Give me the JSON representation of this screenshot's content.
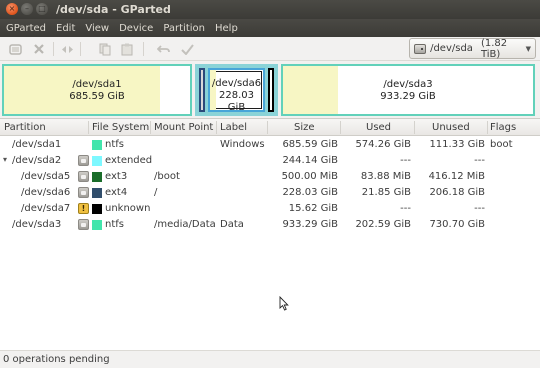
{
  "window": {
    "title": "/dev/sda - GParted",
    "close_glyph": "×",
    "min_glyph": "–",
    "max_glyph": "□"
  },
  "menubar": [
    "GParted",
    "Edit",
    "View",
    "Device",
    "Partition",
    "Help"
  ],
  "toolbar": {
    "icons": [
      "new-icon",
      "delete-icon",
      "resize-icon",
      "copy-icon",
      "paste-icon",
      "undo-icon",
      "apply-icon"
    ],
    "device_name": "/dev/sda",
    "device_size": "(1.82 TiB)"
  },
  "diskmap": {
    "sda1": {
      "name": "/dev/sda1",
      "size": "685.59 GiB",
      "used_fraction": 0.84
    },
    "sda6": {
      "name": "/dev/sda6",
      "size": "228.03 GiB"
    },
    "sda3": {
      "name": "/dev/sda3",
      "size": "933.29 GiB",
      "used_fraction": 0.22
    }
  },
  "columns": [
    "Partition",
    "File System",
    "Mount Point",
    "Label",
    "Size",
    "Used",
    "Unused",
    "Flags"
  ],
  "rows": [
    {
      "partition": "/dev/sda1",
      "fs": "ntfs",
      "fs_color": "#42e5ac",
      "mount": "",
      "label": "Windows",
      "size": "685.59 GiB",
      "used": "574.26 GiB",
      "unused": "111.33 GiB",
      "flags": "boot",
      "indent": 0,
      "expander": "",
      "icon": "none"
    },
    {
      "partition": "/dev/sda2",
      "fs": "extended",
      "fs_color": "#7df8ff",
      "mount": "",
      "label": "",
      "size": "244.14 GiB",
      "used": "---",
      "unused": "---",
      "flags": "",
      "indent": 0,
      "expander": "▾",
      "icon": "lock"
    },
    {
      "partition": "/dev/sda5",
      "fs": "ext3",
      "fs_color": "#1a6d2a",
      "mount": "/boot",
      "label": "",
      "size": "500.00 MiB",
      "used": "83.88 MiB",
      "unused": "416.12 MiB",
      "flags": "",
      "indent": 1,
      "expander": "",
      "icon": "lock"
    },
    {
      "partition": "/dev/sda6",
      "fs": "ext4",
      "fs_color": "#314e6c",
      "mount": "/",
      "label": "",
      "size": "228.03 GiB",
      "used": "21.85 GiB",
      "unused": "206.18 GiB",
      "flags": "",
      "indent": 1,
      "expander": "",
      "icon": "lock"
    },
    {
      "partition": "/dev/sda7",
      "fs": "unknown",
      "fs_color": "#000000",
      "mount": "",
      "label": "",
      "size": "15.62 GiB",
      "used": "---",
      "unused": "---",
      "flags": "",
      "indent": 1,
      "expander": "",
      "icon": "warn"
    },
    {
      "partition": "/dev/sda3",
      "fs": "ntfs",
      "fs_color": "#42e5ac",
      "mount": "/media/Data",
      "label": "Data",
      "size": "933.29 GiB",
      "used": "202.59 GiB",
      "unused": "730.70 GiB",
      "flags": "",
      "indent": 0,
      "expander": "",
      "icon": "lock"
    }
  ],
  "status": "0 operations pending",
  "colors": {
    "used_fill": "#f7f6c4",
    "sda3_border": "#62d1ba"
  }
}
